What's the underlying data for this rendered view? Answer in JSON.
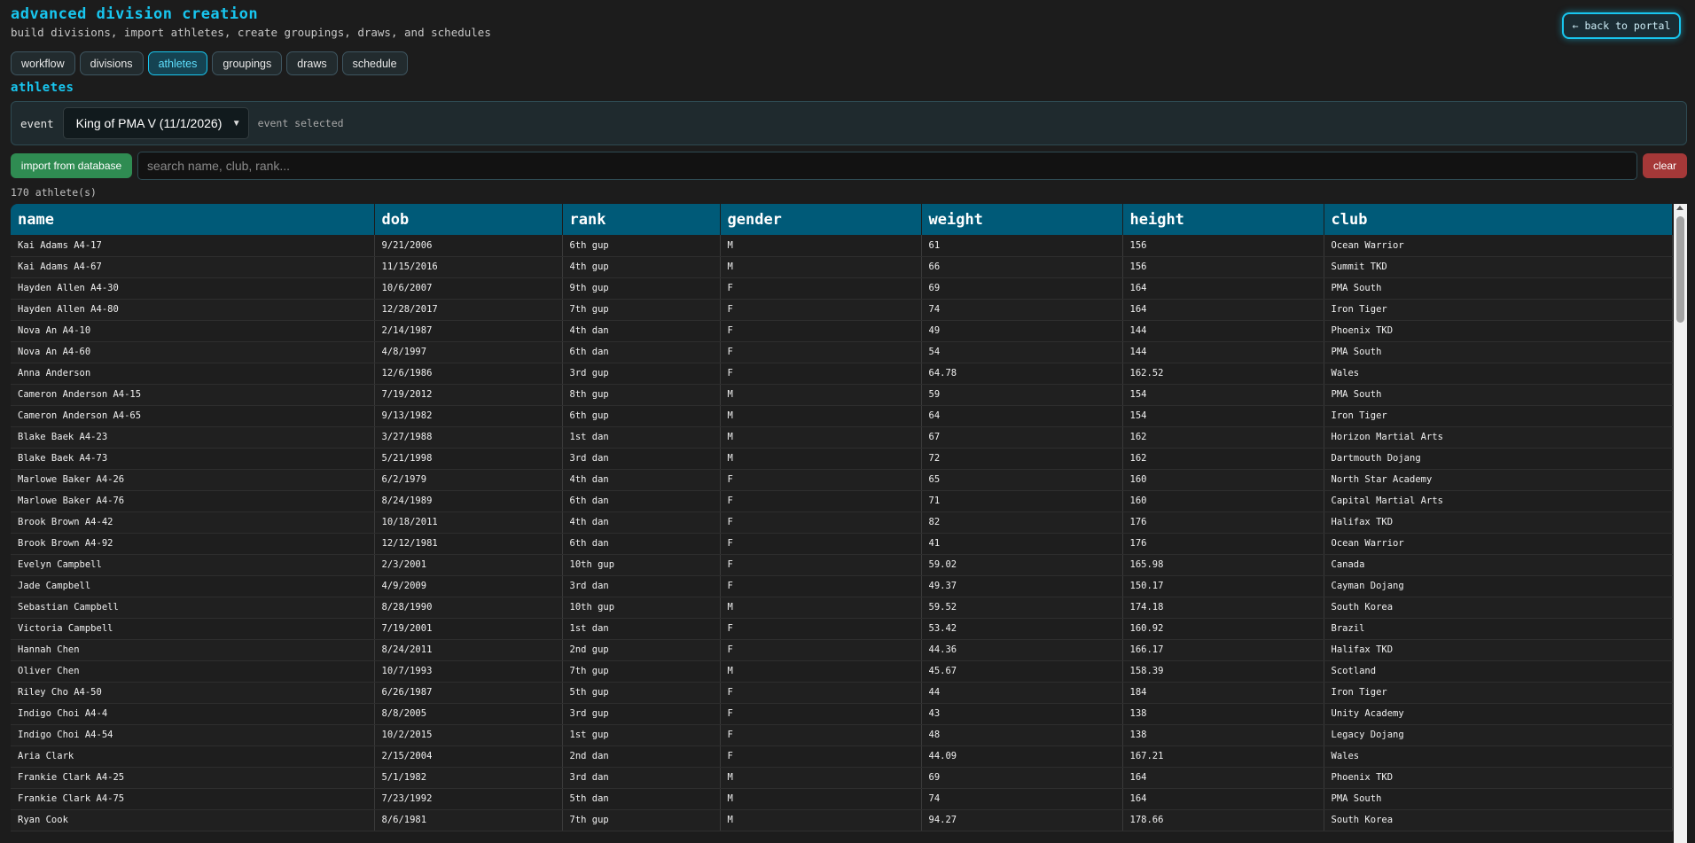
{
  "header": {
    "title": "advanced division creation",
    "subtitle": "build divisions, import athletes, create groupings, draws, and schedules",
    "back_label": "← back to portal"
  },
  "tabs": [
    {
      "label": "workflow",
      "active": false
    },
    {
      "label": "divisions",
      "active": false
    },
    {
      "label": "athletes",
      "active": true
    },
    {
      "label": "groupings",
      "active": false
    },
    {
      "label": "draws",
      "active": false
    },
    {
      "label": "schedule",
      "active": false
    }
  ],
  "section_title": "athletes",
  "event": {
    "label": "event",
    "selected": "King of PMA V (11/1/2026)",
    "status": "event selected"
  },
  "toolbar": {
    "import_label": "import from database",
    "search_placeholder": "search name, club, rank...",
    "search_value": "",
    "clear_label": "clear"
  },
  "count_text": "170 athlete(s)",
  "table": {
    "columns": [
      "name",
      "dob",
      "rank",
      "gender",
      "weight",
      "height",
      "club"
    ],
    "rows": [
      [
        "Kai Adams A4-17",
        "9/21/2006",
        "6th gup",
        "M",
        "61",
        "156",
        "Ocean Warrior"
      ],
      [
        "Kai Adams A4-67",
        "11/15/2016",
        "4th gup",
        "M",
        "66",
        "156",
        "Summit TKD"
      ],
      [
        "Hayden Allen A4-30",
        "10/6/2007",
        "9th gup",
        "F",
        "69",
        "164",
        "PMA South"
      ],
      [
        "Hayden Allen A4-80",
        "12/28/2017",
        "7th gup",
        "F",
        "74",
        "164",
        "Iron Tiger"
      ],
      [
        "Nova An A4-10",
        "2/14/1987",
        "4th dan",
        "F",
        "49",
        "144",
        "Phoenix TKD"
      ],
      [
        "Nova An A4-60",
        "4/8/1997",
        "6th dan",
        "F",
        "54",
        "144",
        "PMA South"
      ],
      [
        "Anna Anderson",
        "12/6/1986",
        "3rd gup",
        "F",
        "64.78",
        "162.52",
        "Wales"
      ],
      [
        "Cameron Anderson A4-15",
        "7/19/2012",
        "8th gup",
        "M",
        "59",
        "154",
        "PMA South"
      ],
      [
        "Cameron Anderson A4-65",
        "9/13/1982",
        "6th gup",
        "M",
        "64",
        "154",
        "Iron Tiger"
      ],
      [
        "Blake Baek A4-23",
        "3/27/1988",
        "1st dan",
        "M",
        "67",
        "162",
        "Horizon Martial Arts"
      ],
      [
        "Blake Baek A4-73",
        "5/21/1998",
        "3rd dan",
        "M",
        "72",
        "162",
        "Dartmouth Dojang"
      ],
      [
        "Marlowe Baker A4-26",
        "6/2/1979",
        "4th dan",
        "F",
        "65",
        "160",
        "North Star Academy"
      ],
      [
        "Marlowe Baker A4-76",
        "8/24/1989",
        "6th dan",
        "F",
        "71",
        "160",
        "Capital Martial Arts"
      ],
      [
        "Brook Brown A4-42",
        "10/18/2011",
        "4th dan",
        "F",
        "82",
        "176",
        "Halifax TKD"
      ],
      [
        "Brook Brown A4-92",
        "12/12/1981",
        "6th dan",
        "F",
        "41",
        "176",
        "Ocean Warrior"
      ],
      [
        "Evelyn Campbell",
        "2/3/2001",
        "10th gup",
        "F",
        "59.02",
        "165.98",
        "Canada"
      ],
      [
        "Jade Campbell",
        "4/9/2009",
        "3rd dan",
        "F",
        "49.37",
        "150.17",
        "Cayman Dojang"
      ],
      [
        "Sebastian Campbell",
        "8/28/1990",
        "10th gup",
        "M",
        "59.52",
        "174.18",
        "South Korea"
      ],
      [
        "Victoria Campbell",
        "7/19/2001",
        "1st dan",
        "F",
        "53.42",
        "160.92",
        "Brazil"
      ],
      [
        "Hannah Chen",
        "8/24/2011",
        "2nd gup",
        "F",
        "44.36",
        "166.17",
        "Halifax TKD"
      ],
      [
        "Oliver Chen",
        "10/7/1993",
        "7th gup",
        "M",
        "45.67",
        "158.39",
        "Scotland"
      ],
      [
        "Riley Cho A4-50",
        "6/26/1987",
        "5th gup",
        "F",
        "44",
        "184",
        "Iron Tiger"
      ],
      [
        "Indigo Choi A4-4",
        "8/8/2005",
        "3rd gup",
        "F",
        "43",
        "138",
        "Unity Academy"
      ],
      [
        "Indigo Choi A4-54",
        "10/2/2015",
        "1st gup",
        "F",
        "48",
        "138",
        "Legacy Dojang"
      ],
      [
        "Aria Clark",
        "2/15/2004",
        "2nd dan",
        "F",
        "44.09",
        "167.21",
        "Wales"
      ],
      [
        "Frankie Clark A4-25",
        "5/1/1982",
        "3rd dan",
        "M",
        "69",
        "164",
        "Phoenix TKD"
      ],
      [
        "Frankie Clark A4-75",
        "7/23/1992",
        "5th dan",
        "M",
        "74",
        "164",
        "PMA South"
      ],
      [
        "Ryan Cook",
        "8/6/1981",
        "7th gup",
        "M",
        "94.27",
        "178.66",
        "South Korea"
      ]
    ]
  }
}
